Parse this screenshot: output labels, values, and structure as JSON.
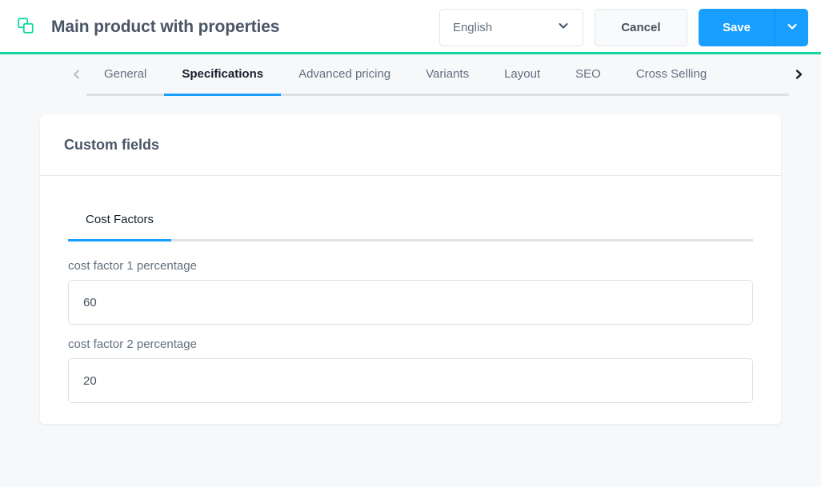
{
  "header": {
    "icon": "copy-duplicate-icon",
    "title": "Main product with properties",
    "language_select": {
      "value": "English",
      "chevron_icon": "chevron-down-icon"
    },
    "cancel_label": "Cancel",
    "save_label": "Save",
    "save_toggle_icon": "chevron-down-icon",
    "accent_green": "#16d6a4",
    "accent_blue": "#189eff"
  },
  "tabbar": {
    "prev_icon": "chevron-left-icon",
    "next_icon": "chevron-right-icon",
    "tabs": [
      {
        "label": "General",
        "active": false
      },
      {
        "label": "Specifications",
        "active": true
      },
      {
        "label": "Advanced pricing",
        "active": false
      },
      {
        "label": "Variants",
        "active": false
      },
      {
        "label": "Layout",
        "active": false
      },
      {
        "label": "SEO",
        "active": false
      },
      {
        "label": "Cross Selling",
        "active": false
      }
    ]
  },
  "card": {
    "title": "Custom fields",
    "inner_tabs": [
      {
        "label": "Cost Factors",
        "active": true
      }
    ],
    "fields": [
      {
        "label": "cost factor 1 percentage",
        "value": "60",
        "placeholder": ""
      },
      {
        "label": "cost factor 2 percentage",
        "value": "20",
        "placeholder": ""
      }
    ]
  }
}
